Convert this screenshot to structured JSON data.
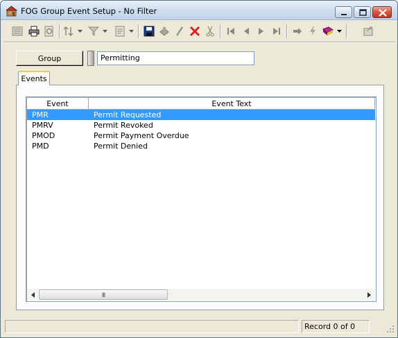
{
  "window": {
    "title": "FOG Group Event Setup - No Filter"
  },
  "group": {
    "button_label": "Group",
    "value": "Permitting"
  },
  "tabs": [
    {
      "label": "Events"
    }
  ],
  "grid": {
    "columns": [
      "Event",
      "Event Text"
    ],
    "rows": [
      {
        "event": "PMR",
        "text": "Permit Requested",
        "selected": true
      },
      {
        "event": "PMRV",
        "text": "Permit Revoked",
        "selected": false
      },
      {
        "event": "PMOD",
        "text": "Permit Payment Overdue",
        "selected": false
      },
      {
        "event": "PMD",
        "text": "Permit Denied",
        "selected": false
      }
    ],
    "scroll_thumb_glyph": "III"
  },
  "status": {
    "record": "Record 0 of 0"
  },
  "colors": {
    "selection": "#3399ff",
    "delete_icon": "#e02020",
    "save_icon": "#1a3a8a"
  },
  "toolbar_icons": [
    "list-icon",
    "print-icon",
    "print-preview-icon",
    "sort-icon",
    "filter-icon",
    "report-icon",
    "save-icon",
    "stamp-icon",
    "edit-icon",
    "delete-icon",
    "cut-icon",
    "first-record-icon",
    "previous-record-icon",
    "next-record-icon",
    "last-record-icon",
    "goto-icon",
    "lightning-icon",
    "book-icon",
    "exit-icon"
  ]
}
